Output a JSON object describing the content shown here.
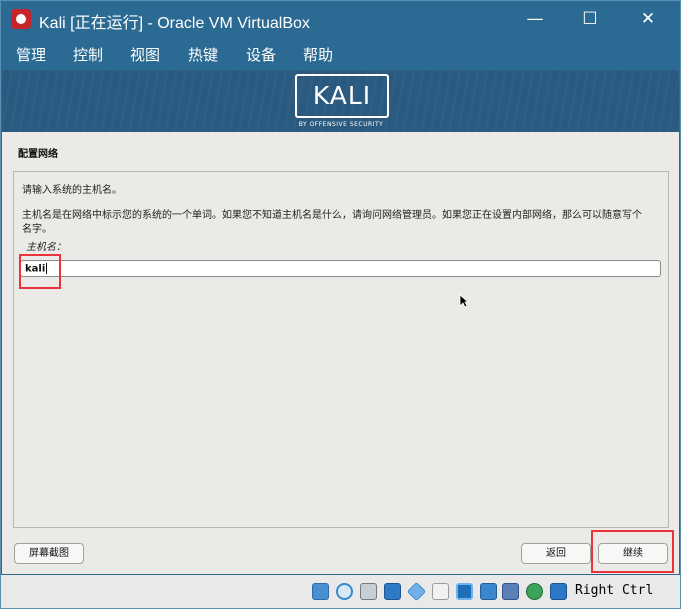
{
  "window": {
    "title": "Kali [正在运行] - Oracle VM VirtualBox",
    "minimize_glyph": "—",
    "maximize_glyph": "☐",
    "close_glyph": "✕"
  },
  "menubar": {
    "items": [
      "管理",
      "控制",
      "视图",
      "热键",
      "设备",
      "帮助"
    ]
  },
  "banner": {
    "logo_text": "KALI",
    "logo_subtitle": "BY OFFENSIVE SECURITY"
  },
  "installer": {
    "section_title": "配置网络",
    "prompt": "请输入系统的主机名。",
    "description_line1": "主机名是在网络中标示您的系统的一个单词。如果您不知道主机名是什么，请询问网络管理员。如果您正在设置内部网络，那么可以随意写个",
    "description_line2": "名字。",
    "field_label": "主机名：",
    "hostname_value": "kali"
  },
  "buttons": {
    "screenshot": "屏幕截图",
    "back": "返回",
    "continue": "继续"
  },
  "statusbar": {
    "icons": [
      "hard-disk-icon",
      "optical-disc-icon",
      "audio-icon",
      "network-icon",
      "usb-icon",
      "shared-folder-icon",
      "display-icon",
      "video-capture-icon",
      "recording-icon",
      "virtualization-icon",
      "mouse-integration-icon",
      "keyboard-capture-icon"
    ],
    "host_key": "Right Ctrl"
  },
  "colors": {
    "titlebar": "#2b6a93",
    "highlight": "#e8343a",
    "installer_bg": "#ebeae6"
  }
}
